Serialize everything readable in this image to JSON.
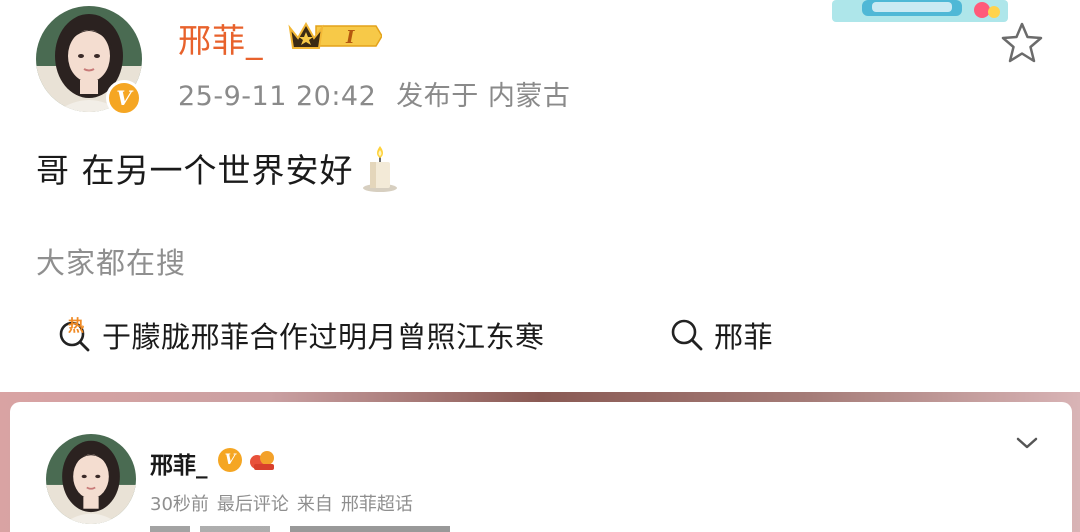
{
  "post": {
    "username": "邢菲_",
    "vip_level": "I",
    "timestamp": "25-9-11 20:42",
    "location_label": "发布于 内蒙古",
    "text": "哥 在另一个世界安好",
    "verified_badge": "V"
  },
  "search_section": {
    "heading": "大家都在搜",
    "hot_icon_char": "热",
    "items": [
      {
        "label": "于朦胧邢菲合作过明月曾照江东寒",
        "icon": "hot-search-icon"
      },
      {
        "label": "邢菲",
        "icon": "search-icon"
      }
    ]
  },
  "comment_card": {
    "username": "邢菲_",
    "verified_badge": "V",
    "meta": [
      "30秒前",
      "最后评论",
      "来自",
      "邢菲超话"
    ]
  },
  "colors": {
    "username_orange": "#e8622c",
    "meta_gray": "#8a8a8a",
    "badge_gold": "#f5a623",
    "hot_orange": "#f08a24"
  }
}
